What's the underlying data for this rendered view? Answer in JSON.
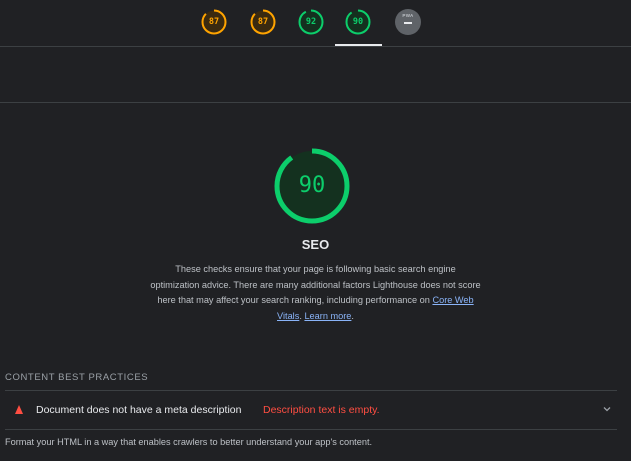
{
  "top_nav": {
    "scores": [
      {
        "value": "87",
        "score": 0.87,
        "color": "#ffa400",
        "track": "#3a2a10"
      },
      {
        "value": "87",
        "score": 0.87,
        "color": "#ffa400",
        "track": "#3a2a10"
      },
      {
        "value": "92",
        "score": 0.92,
        "color": "#0cce6b",
        "track": "#14311f"
      },
      {
        "value": "90",
        "score": 0.9,
        "color": "#0cce6b",
        "track": "#14311f"
      }
    ],
    "pwa_label": "PWA"
  },
  "category": {
    "score": "90",
    "score_fraction": 0.9,
    "gauge_color": "#0cce6b",
    "title": "SEO",
    "description_before": "These checks ensure that your page is following basic search engine optimization advice. There are many additional factors Lighthouse does not score here that may affect your search ranking, including performance on ",
    "link1": "Core Web Vitals",
    "description_between": ". ",
    "link2": "Learn more",
    "description_after": "."
  },
  "group": {
    "title": "CONTENT BEST PRACTICES"
  },
  "audit": {
    "title": "Document does not have a meta description",
    "display_value": "Description text is empty.",
    "description": "Format your HTML in a way that enables crawlers to better understand your app's content.",
    "status_color": "#ff4e42"
  }
}
